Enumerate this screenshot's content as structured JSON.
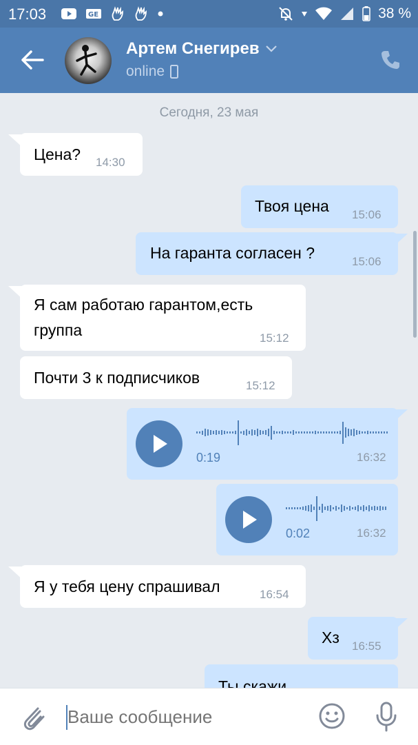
{
  "status_bar": {
    "time": "17:03",
    "battery": "38 %"
  },
  "header": {
    "name": "Артем Снегирев",
    "status": "online"
  },
  "chat": {
    "date": "Сегодня, 23 мая",
    "messages": [
      {
        "text": "Цена?",
        "time": "14:30"
      },
      {
        "text": "Твоя цена",
        "time": "15:06"
      },
      {
        "text": "На гаранта согласен ?",
        "time": "15:06"
      },
      {
        "text_line1": "Я сам работаю гарантом,есть",
        "text_line2": "группа",
        "time": "15:12"
      },
      {
        "text": "Почти 3 к подписчиков",
        "time": "15:12"
      },
      {
        "duration": "0:19",
        "time": "16:32"
      },
      {
        "duration": "0:02",
        "time": "16:32"
      },
      {
        "text": "Я у тебя цену спрашивал",
        "time": "16:54"
      },
      {
        "text": "Хз",
        "time": "16:55"
      },
      {
        "text": "Ты скажи"
      }
    ]
  },
  "composer": {
    "placeholder": "Ваше сообщение"
  },
  "colors": {
    "header": "#5181b8",
    "incoming": "#ffffff",
    "outgoing": "#cce4ff",
    "background": "#e7ebf0"
  }
}
